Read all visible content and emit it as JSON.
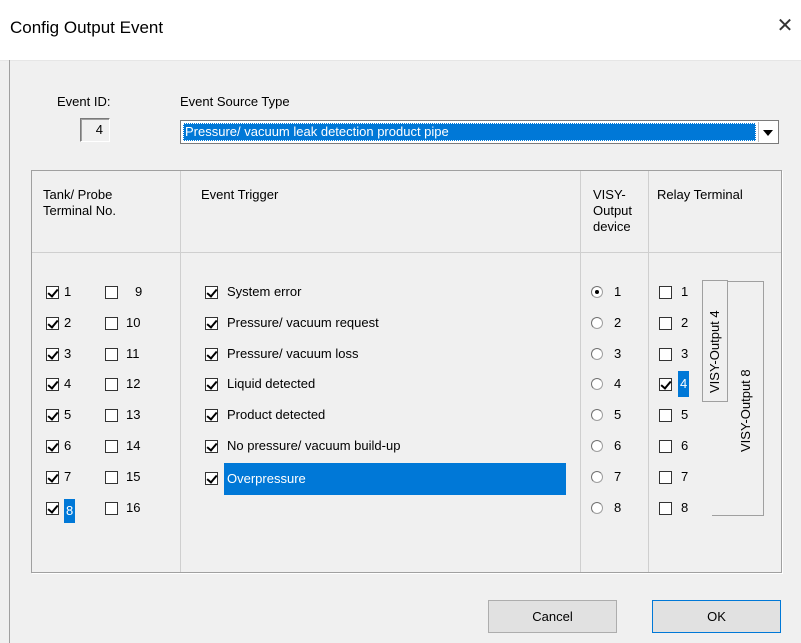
{
  "window": {
    "title": "Config Output Event",
    "close_glyph": "✕"
  },
  "event_id": {
    "label": "Event ID:",
    "value": "4"
  },
  "event_source": {
    "label": "Event Source Type",
    "selected": "Pressure/ vacuum leak detection product pipe"
  },
  "headers": {
    "tank_line1": "Tank/ Probe",
    "tank_line2": "Terminal No.",
    "trigger": "Event Trigger",
    "visy_line1": "VISY-",
    "visy_line2": "Output",
    "visy_line3": "device",
    "relay": "Relay Terminal"
  },
  "tanks_left": [
    {
      "n": "1",
      "checked": true
    },
    {
      "n": "2",
      "checked": true
    },
    {
      "n": "3",
      "checked": true
    },
    {
      "n": "4",
      "checked": true
    },
    {
      "n": "5",
      "checked": true
    },
    {
      "n": "6",
      "checked": true
    },
    {
      "n": "7",
      "checked": true
    },
    {
      "n": "8",
      "checked": true,
      "focused": true
    }
  ],
  "tanks_right": [
    {
      "n": "9",
      "checked": false
    },
    {
      "n": "10",
      "checked": false
    },
    {
      "n": "11",
      "checked": false
    },
    {
      "n": "12",
      "checked": false
    },
    {
      "n": "13",
      "checked": false
    },
    {
      "n": "14",
      "checked": false
    },
    {
      "n": "15",
      "checked": false
    },
    {
      "n": "16",
      "checked": false
    }
  ],
  "triggers": [
    {
      "label": "System error",
      "checked": true
    },
    {
      "label": "Pressure/ vacuum request",
      "checked": true
    },
    {
      "label": "Pressure/ vacuum loss",
      "checked": true
    },
    {
      "label": "Liquid detected",
      "checked": true
    },
    {
      "label": "Product detected",
      "checked": true
    },
    {
      "label": "No pressure/ vacuum build-up",
      "checked": true
    },
    {
      "label": "Overpressure",
      "checked": true,
      "focused": true
    }
  ],
  "visy_devices": [
    {
      "n": "1",
      "selected": true
    },
    {
      "n": "2",
      "selected": false
    },
    {
      "n": "3",
      "selected": false
    },
    {
      "n": "4",
      "selected": false
    },
    {
      "n": "5",
      "selected": false
    },
    {
      "n": "6",
      "selected": false
    },
    {
      "n": "7",
      "selected": false
    },
    {
      "n": "8",
      "selected": false
    }
  ],
  "relays": [
    {
      "n": "1",
      "checked": false
    },
    {
      "n": "2",
      "checked": false
    },
    {
      "n": "3",
      "checked": false
    },
    {
      "n": "4",
      "checked": true,
      "focused": true
    },
    {
      "n": "5",
      "checked": false
    },
    {
      "n": "6",
      "checked": false
    },
    {
      "n": "7",
      "checked": false
    },
    {
      "n": "8",
      "checked": false
    }
  ],
  "relay_groups": {
    "group4": "VISY-Output 4",
    "group8": "VISY-Output 8"
  },
  "buttons": {
    "cancel": "Cancel",
    "ok": "OK"
  },
  "colors": {
    "selection": "#0078d7",
    "background": "#f0f0f0"
  }
}
